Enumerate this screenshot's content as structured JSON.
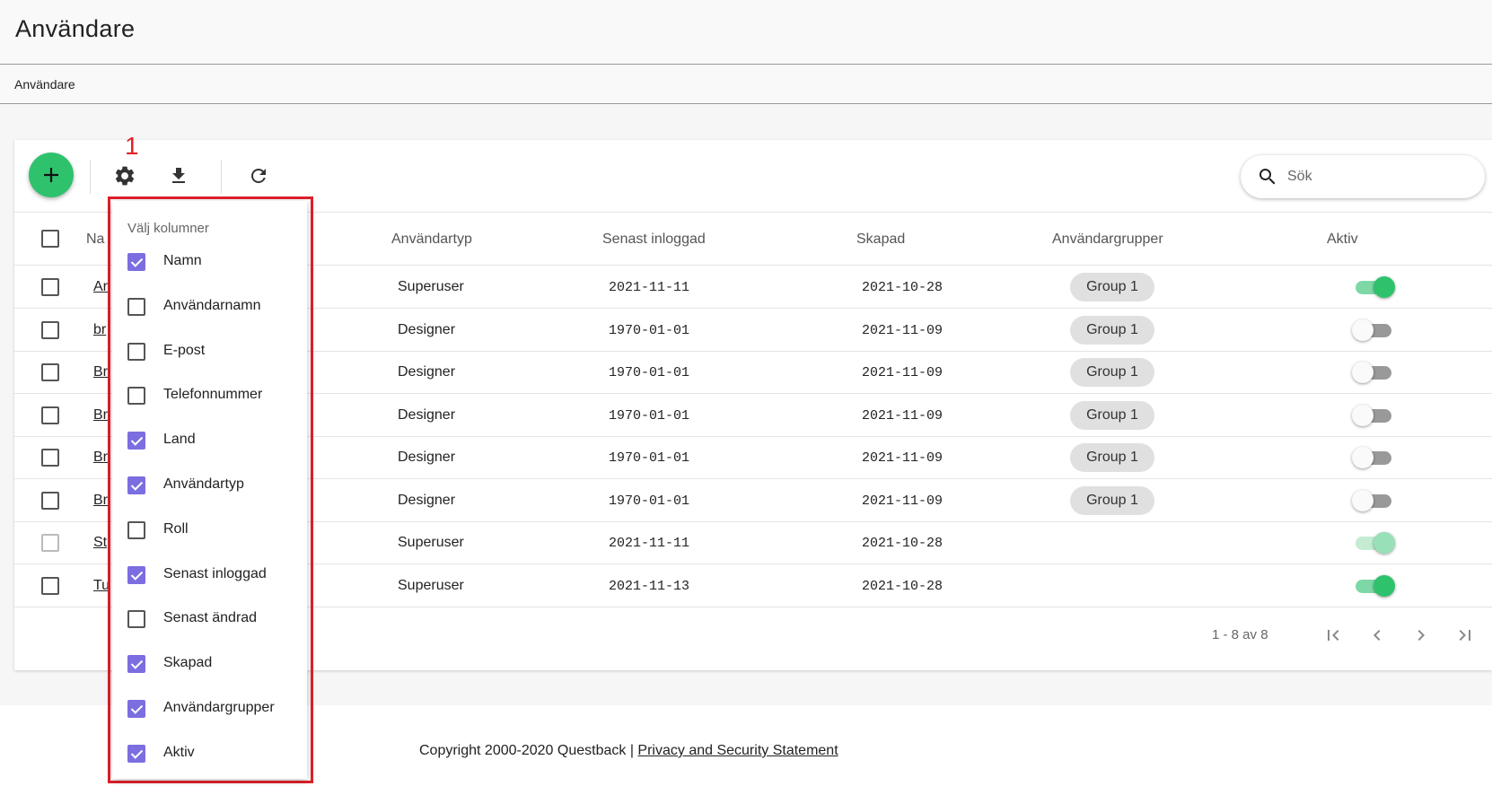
{
  "page": {
    "title": "Användare",
    "breadcrumb": "Användare"
  },
  "toolbar": {
    "annotation_badge": "1",
    "search_placeholder": "Sök"
  },
  "table": {
    "headers": {
      "name": "Namn",
      "user_type": "Användartyp",
      "last_login": "Senast inloggad",
      "created": "Skapad",
      "user_groups": "Användargrupper",
      "active": "Aktiv"
    },
    "name_header_visible": "Na",
    "rows": [
      {
        "name": "Ar",
        "user_type": "Superuser",
        "last_login": "2021-11-11",
        "created": "2021-10-28",
        "group": "Group 1",
        "active": true
      },
      {
        "name": "br",
        "user_type": "Designer",
        "last_login": "1970-01-01",
        "created": "2021-11-09",
        "group": "Group 1",
        "active": false
      },
      {
        "name": "Br",
        "user_type": "Designer",
        "last_login": "1970-01-01",
        "created": "2021-11-09",
        "group": "Group 1",
        "active": false
      },
      {
        "name": "Br",
        "user_type": "Designer",
        "last_login": "1970-01-01",
        "created": "2021-11-09",
        "group": "Group 1",
        "active": false
      },
      {
        "name": "Br",
        "user_type": "Designer",
        "last_login": "1970-01-01",
        "created": "2021-11-09",
        "group": "Group 1",
        "active": false
      },
      {
        "name": "Br",
        "user_type": "Designer",
        "last_login": "1970-01-01",
        "created": "2021-11-09",
        "group": "Group 1",
        "active": false
      },
      {
        "name": "St",
        "user_type": "Superuser",
        "last_login": "2021-11-11",
        "created": "2021-10-28",
        "group": "",
        "active": true
      },
      {
        "name": "Tu",
        "user_type": "Superuser",
        "last_login": "2021-11-13",
        "created": "2021-10-28",
        "group": "",
        "active": true
      }
    ]
  },
  "pagination": {
    "range_text": "1 - 8 av 8"
  },
  "column_picker": {
    "title": "Välj kolumner",
    "items": [
      {
        "label": "Namn",
        "checked": true
      },
      {
        "label": "Användarnamn",
        "checked": false
      },
      {
        "label": "E-post",
        "checked": false
      },
      {
        "label": "Telefonnummer",
        "checked": false
      },
      {
        "label": "Land",
        "checked": true
      },
      {
        "label": "Användartyp",
        "checked": true
      },
      {
        "label": "Roll",
        "checked": false
      },
      {
        "label": "Senast inloggad",
        "checked": true
      },
      {
        "label": "Senast ändrad",
        "checked": false
      },
      {
        "label": "Skapad",
        "checked": true
      },
      {
        "label": "Användargrupper",
        "checked": true
      },
      {
        "label": "Aktiv",
        "checked": true
      }
    ]
  },
  "footer": {
    "copyright": "Copyright 2000-2020 Questback | ",
    "privacy_link": "Privacy and Security Statement"
  },
  "colors": {
    "accent_green": "#2ec26d",
    "checkbox_purple": "#7b6ee0",
    "highlight_red": "#e0202a"
  },
  "icons": [
    "plus-icon",
    "gear-icon",
    "download-icon",
    "refresh-icon",
    "search-icon",
    "first-page-icon",
    "prev-page-icon",
    "next-page-icon",
    "last-page-icon"
  ]
}
